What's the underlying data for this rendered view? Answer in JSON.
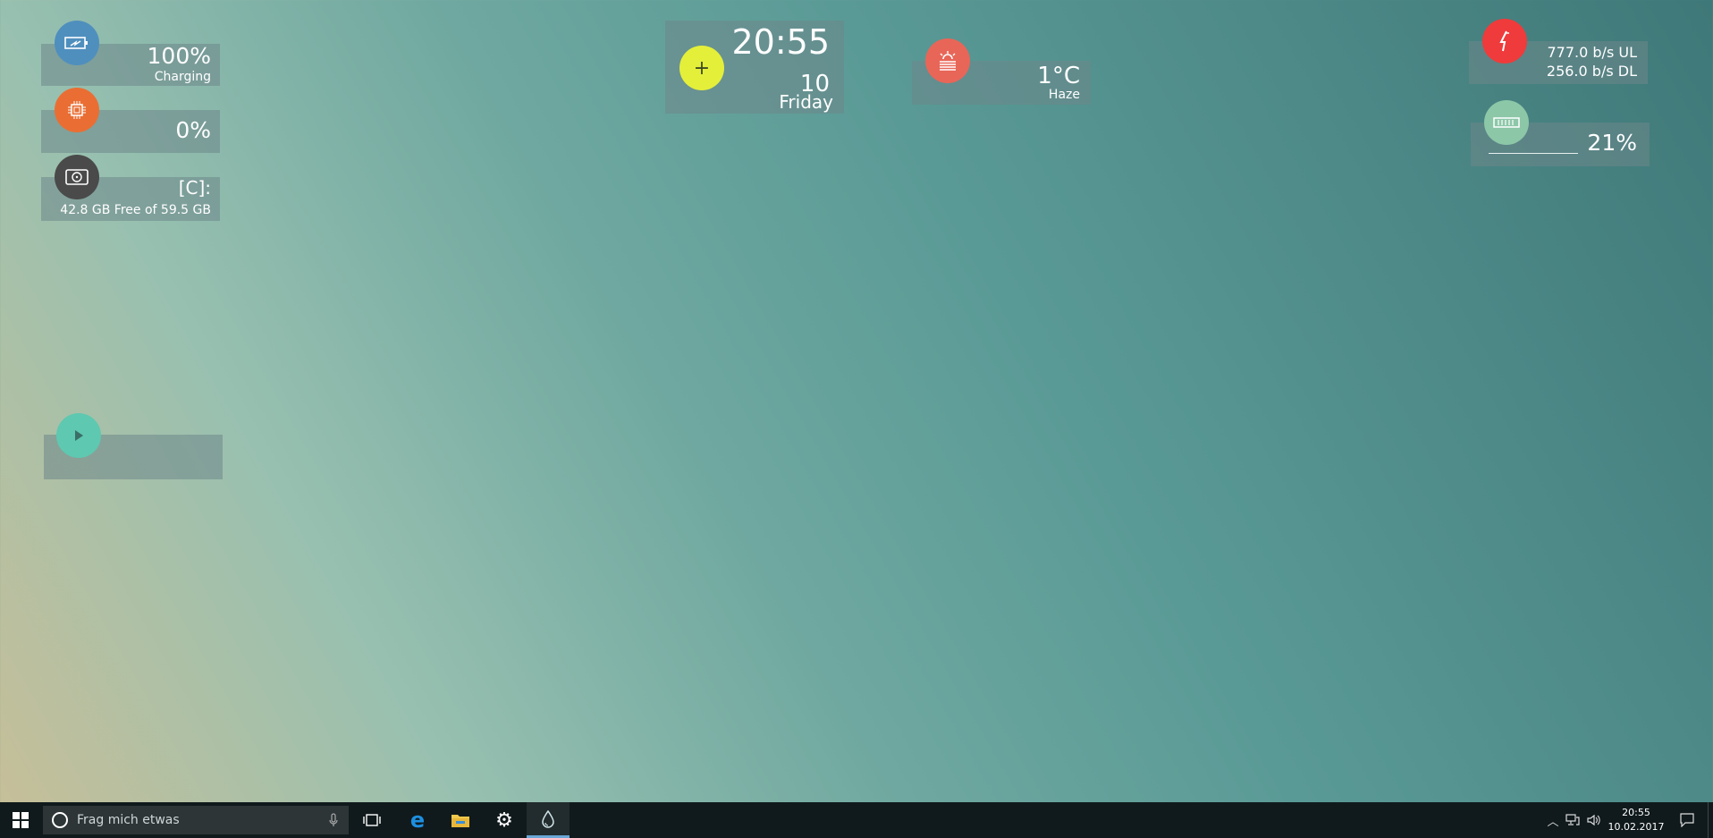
{
  "battery": {
    "percent": "100%",
    "status": "Charging",
    "color": "#4f8fbe"
  },
  "cpu": {
    "percent": "0%",
    "color": "#ea6e33"
  },
  "disk": {
    "label": "[C]:",
    "detail": "42.8 GB Free of 59.5 GB",
    "color": "#4a4a4a"
  },
  "media": {
    "color": "#5ec8b0"
  },
  "clock_widget": {
    "time": "20:55",
    "day_number": "10",
    "weekday": "Friday",
    "plus_label": "+",
    "color": "#e4ef3a"
  },
  "weather": {
    "temperature": "1°C",
    "condition": "Haze",
    "color": "#e86658"
  },
  "network": {
    "upload": "777.0 b/s",
    "upload_unit": "UL",
    "download": "256.0 b/s",
    "download_unit": "DL",
    "color": "#ef3b3b"
  },
  "ram": {
    "percent": "21%",
    "color": "#8cc7a8"
  },
  "taskbar": {
    "search_placeholder": "Frag mich etwas",
    "time": "20:55",
    "date": "10.02.2017",
    "apps": [
      "task-view",
      "edge",
      "file-explorer",
      "settings",
      "rainmeter"
    ]
  }
}
